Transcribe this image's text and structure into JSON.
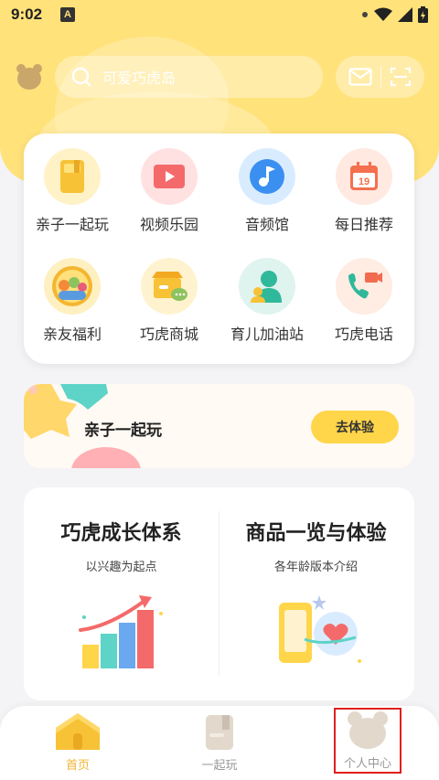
{
  "status_bar": {
    "time": "9:02",
    "notification_badge": "A"
  },
  "search": {
    "placeholder": "可爱巧虎岛"
  },
  "grid": {
    "items": [
      {
        "label": "亲子一起玩",
        "icon": "book-icon",
        "bg": "#fff2c6",
        "color": "#f7c236"
      },
      {
        "label": "视频乐园",
        "icon": "video-play-icon",
        "bg": "#ffe1e1",
        "color": "#f46a6a"
      },
      {
        "label": "音频馆",
        "icon": "music-note-icon",
        "bg": "#d9ecff",
        "color": "#3b8ff0"
      },
      {
        "label": "每日推荐",
        "icon": "calendar-icon",
        "bg": "#ffe9e0",
        "color": "#f4704e"
      },
      {
        "label": "亲友福利",
        "icon": "family-photo-icon",
        "bg": "#fff0c2",
        "color": "#f4b630"
      },
      {
        "label": "巧虎商城",
        "icon": "shop-icon",
        "bg": "#fff3cf",
        "color": "#f7c236"
      },
      {
        "label": "育儿加油站",
        "icon": "parent-icon",
        "bg": "#dff3ef",
        "color": "#2fb99a"
      },
      {
        "label": "巧虎电话",
        "icon": "video-call-icon",
        "bg": "#ffece2",
        "color": "#f26b4f"
      }
    ]
  },
  "banner": {
    "title": "亲子一起玩",
    "cta": "去体验"
  },
  "features": {
    "left": {
      "title": "巧虎成长体系",
      "subtitle": "以兴趣为起点"
    },
    "right": {
      "title": "商品一览与体验",
      "subtitle": "各年龄版本介绍"
    }
  },
  "tabs": [
    {
      "label": "首页",
      "icon": "home-icon",
      "active": true
    },
    {
      "label": "一起玩",
      "icon": "play-book-icon",
      "active": false
    },
    {
      "label": "个人中心",
      "icon": "bear-profile-icon",
      "active": false
    }
  ],
  "colors": {
    "header": "#ffe27a",
    "accent": "#ffd54a",
    "active_tab": "#f2b431",
    "highlight_box": "#e01f1f"
  }
}
